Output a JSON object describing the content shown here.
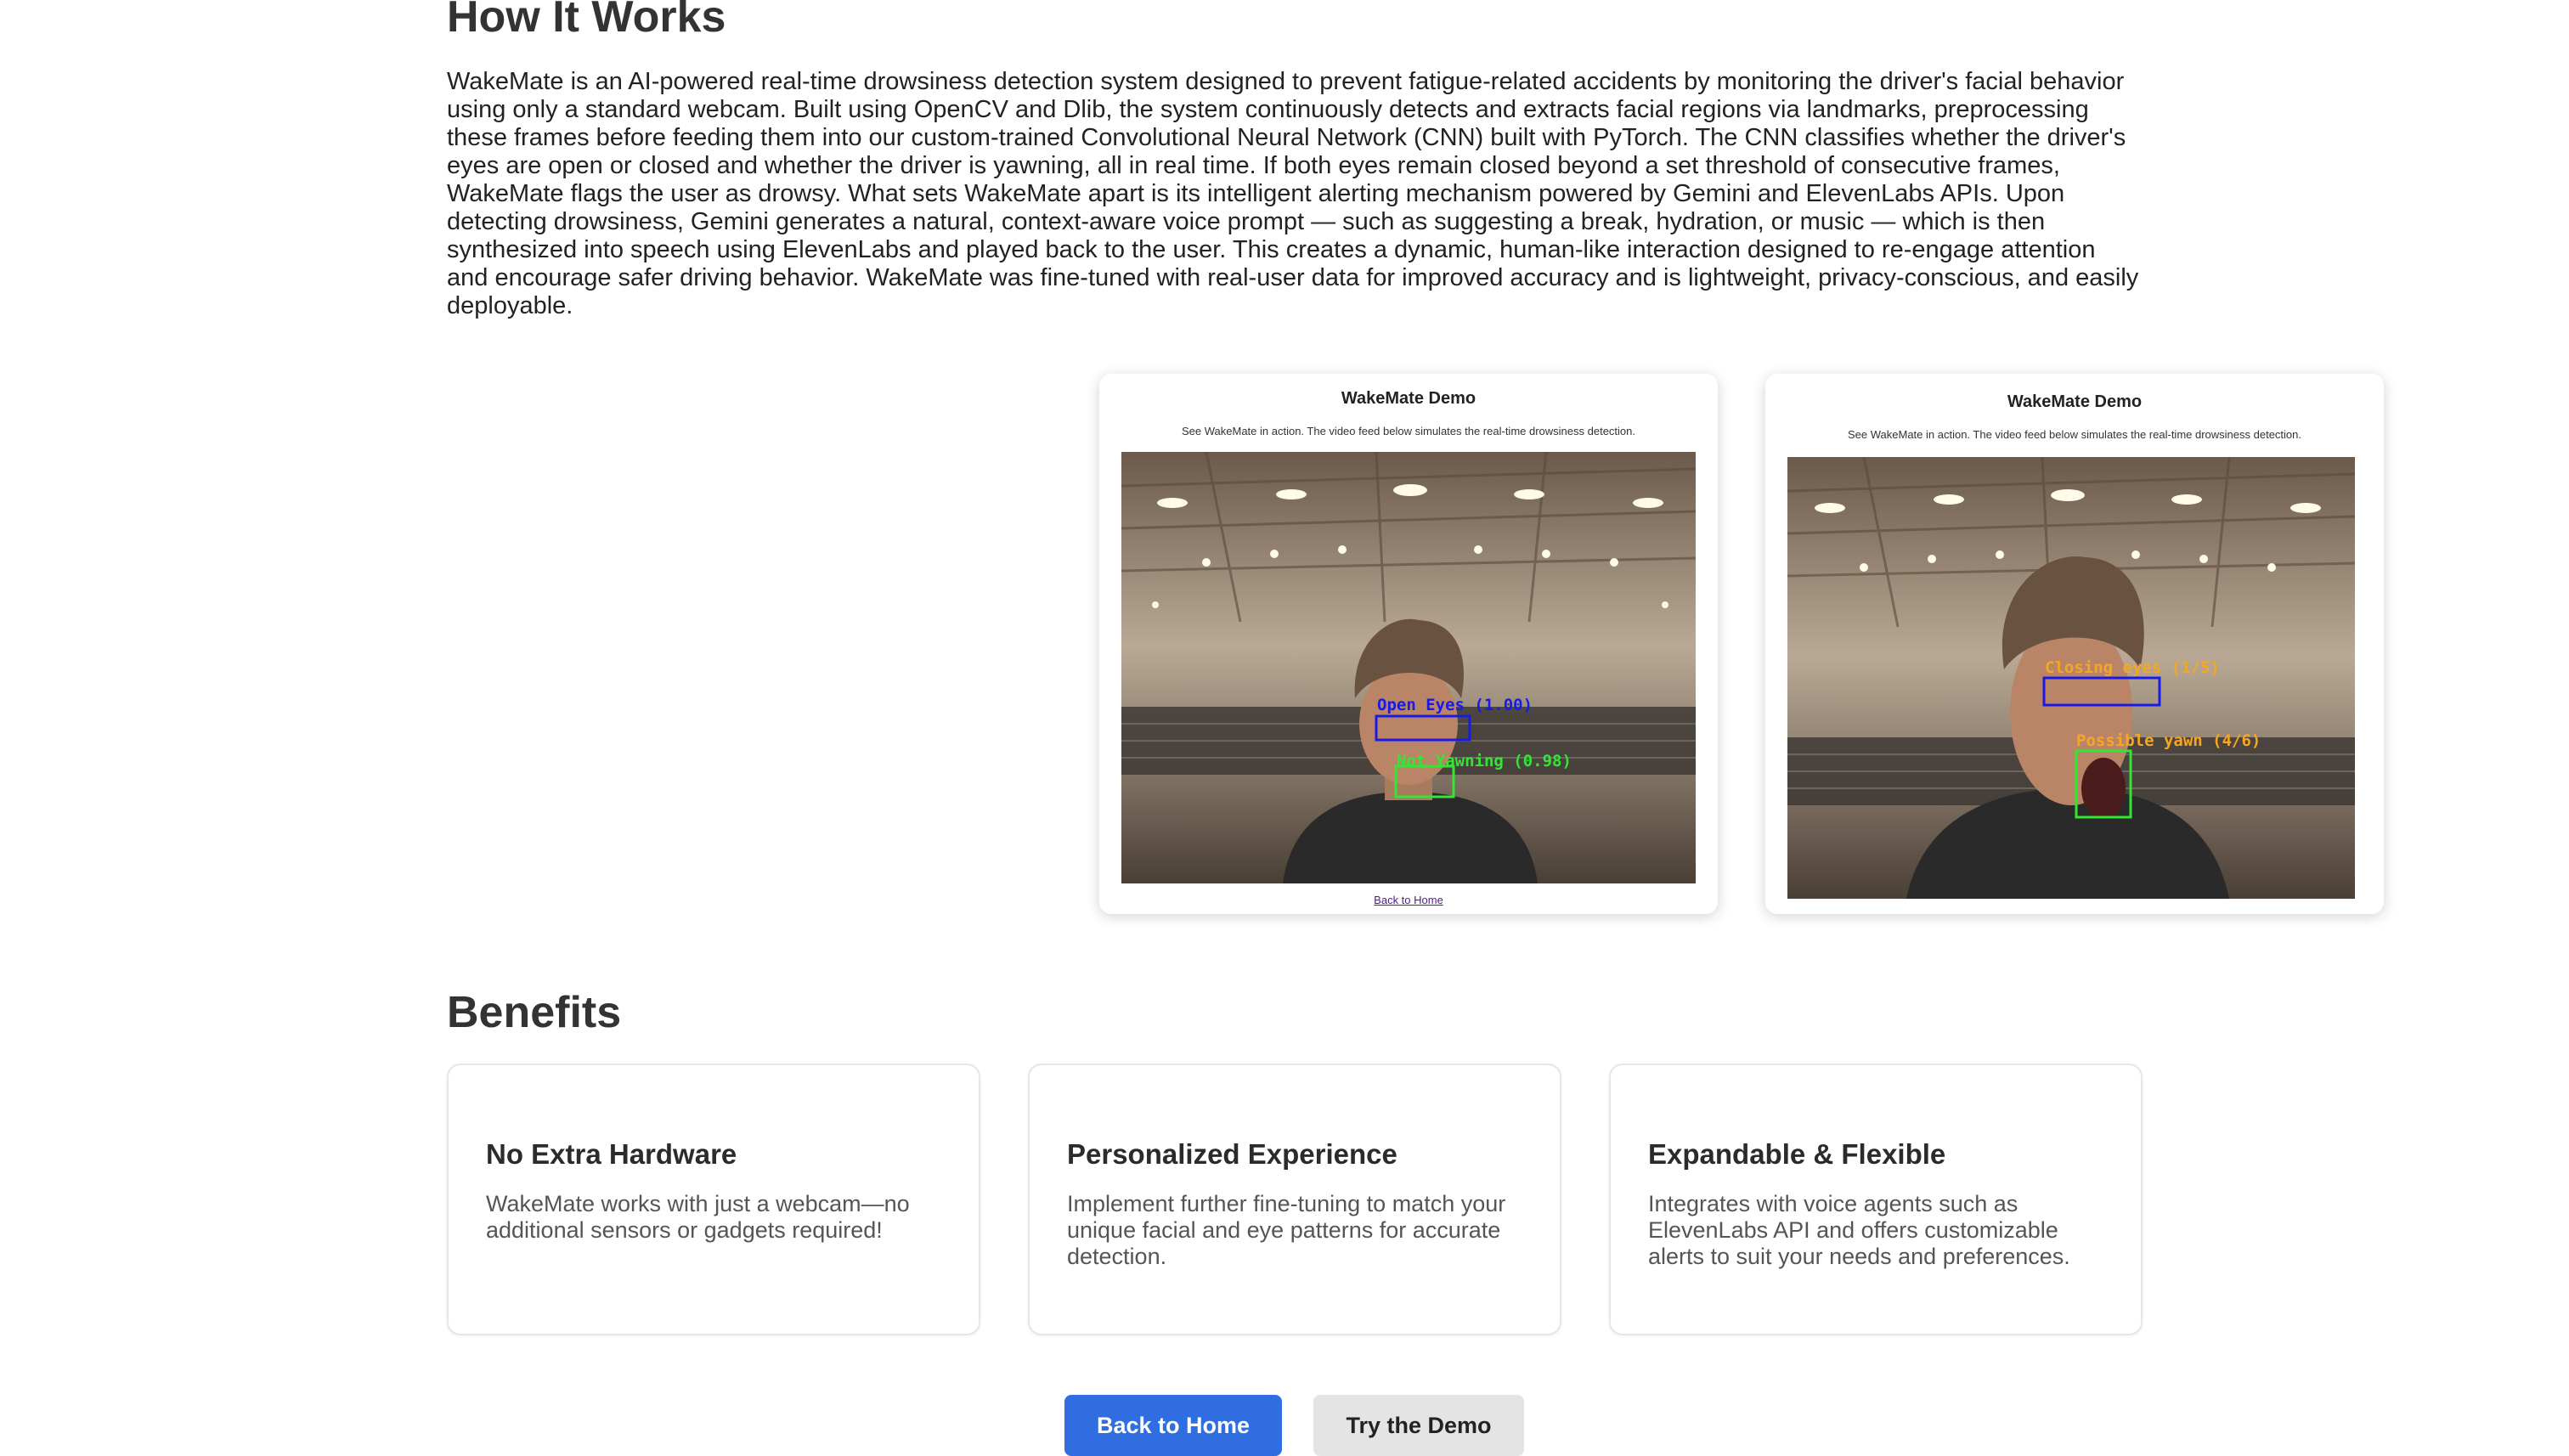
{
  "how": {
    "title": "How It Works",
    "text": "WakeMate is an AI-powered real-time drowsiness detection system designed to prevent fatigue-related accidents by monitoring the driver's facial behavior using only a standard webcam. Built using OpenCV and Dlib, the system continuously detects and extracts facial regions via landmarks, preprocessing these frames before feeding them into our custom-trained Convolutional Neural Network (CNN) built with PyTorch. The CNN classifies whether the driver's eyes are open or closed and whether the driver is yawning, all in real time. If both eyes remain closed beyond a set threshold of consecutive frames, WakeMate flags the user as drowsy. What sets WakeMate apart is its intelligent alerting mechanism powered by Gemini and ElevenLabs APIs. Upon detecting drowsiness, Gemini generates a natural, context-aware voice prompt — such as suggesting a break, hydration, or music — which is then synthesized into speech using ElevenLabs and played back to the user. This creates a dynamic, human-like interaction designed to re-engage attention and encourage safer driving behavior. WakeMate was fine-tuned with real-user data for improved accuracy and is lightweight, privacy-conscious, and easily deployable."
  },
  "demos": [
    {
      "title": "WakeMate Demo",
      "subtitle": "See WakeMate in action. The video feed below simulates the real-time drowsiness detection.",
      "eye_label": "Open Eyes (1.00)",
      "mouth_label": "Not Yawning (0.98)",
      "eye_color": "#1a1ae6",
      "mouth_color": "#33e633",
      "link": "Back to Home"
    },
    {
      "title": "WakeMate Demo",
      "subtitle": "See WakeMate in action. The video feed below simulates the real-time drowsiness detection.",
      "eye_label": "Closing eyes (1/5)",
      "mouth_label": "Possible yawn (4/6)",
      "eye_color": "#1a1ae6",
      "mouth_color": "#33e633",
      "label_color": "#f5a623"
    }
  ],
  "benefits": {
    "title": "Benefits",
    "items": [
      {
        "title": "No Extra Hardware",
        "text": "WakeMate works with just a webcam—no additional sensors or gadgets required!"
      },
      {
        "title": "Personalized Experience",
        "text": "Implement further fine-tuning to match your unique facial and eye patterns for accurate detection."
      },
      {
        "title": "Expandable & Flexible",
        "text": "Integrates with voice agents such as ElevenLabs API and offers customizable alerts to suit your needs and preferences."
      }
    ]
  },
  "buttons": {
    "home": "Back to Home",
    "demo": "Try the Demo"
  },
  "colors": {
    "primary_button": "#2f6de1",
    "secondary_button": "#e4e4e4"
  }
}
